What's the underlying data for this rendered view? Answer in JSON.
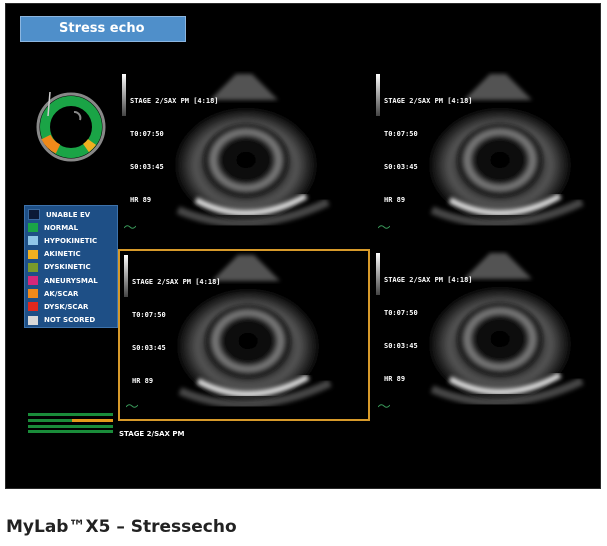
{
  "app": {
    "title": "Stress echo"
  },
  "panes": [
    {
      "label": "STAGE 2/SAX PM [4:18]",
      "t": "T0:07:50",
      "s": "S0:03:45",
      "hr": "HR 89",
      "selected": false
    },
    {
      "label": "STAGE 2/SAX PM [4:18]",
      "t": "T0:07:50",
      "s": "S0:03:45",
      "hr": "HR 89",
      "selected": false
    },
    {
      "label": "STAGE 2/SAX PM [4:18]",
      "t": "T0:07:50",
      "s": "S0:03:45",
      "hr": "HR 89",
      "selected": true
    },
    {
      "label": "STAGE 2/SAX PM [4:18]",
      "t": "T0:07:50",
      "s": "S0:03:45",
      "hr": "HR 89",
      "selected": false
    }
  ],
  "legend": [
    {
      "label": "UNABLE EV",
      "color": "#0b1a36"
    },
    {
      "label": "NORMAL",
      "color": "#1aa446"
    },
    {
      "label": "HYPOKINETIC",
      "color": "#8fc6e8"
    },
    {
      "label": "AKINETIC",
      "color": "#f0b020"
    },
    {
      "label": "DYSKINETIC",
      "color": "#7a9a2a"
    },
    {
      "label": "ANEURYSMAL",
      "color": "#d6287a"
    },
    {
      "label": "AK/SCAR",
      "color": "#f08a1a"
    },
    {
      "label": "DYSK/SCAR",
      "color": "#e0281e"
    },
    {
      "label": "NOT SCORED",
      "color": "#d8d8d8"
    }
  ],
  "stage_caption": "STAGE 2/SAX PM",
  "caption": "MyLab™X5 – Stressecho",
  "colors": {
    "accent": "#4f8fca",
    "selection": "#d79a2a",
    "normal": "#1aa446",
    "akscar": "#f08a1a"
  },
  "progress": {
    "segment_fraction": 0.5
  }
}
